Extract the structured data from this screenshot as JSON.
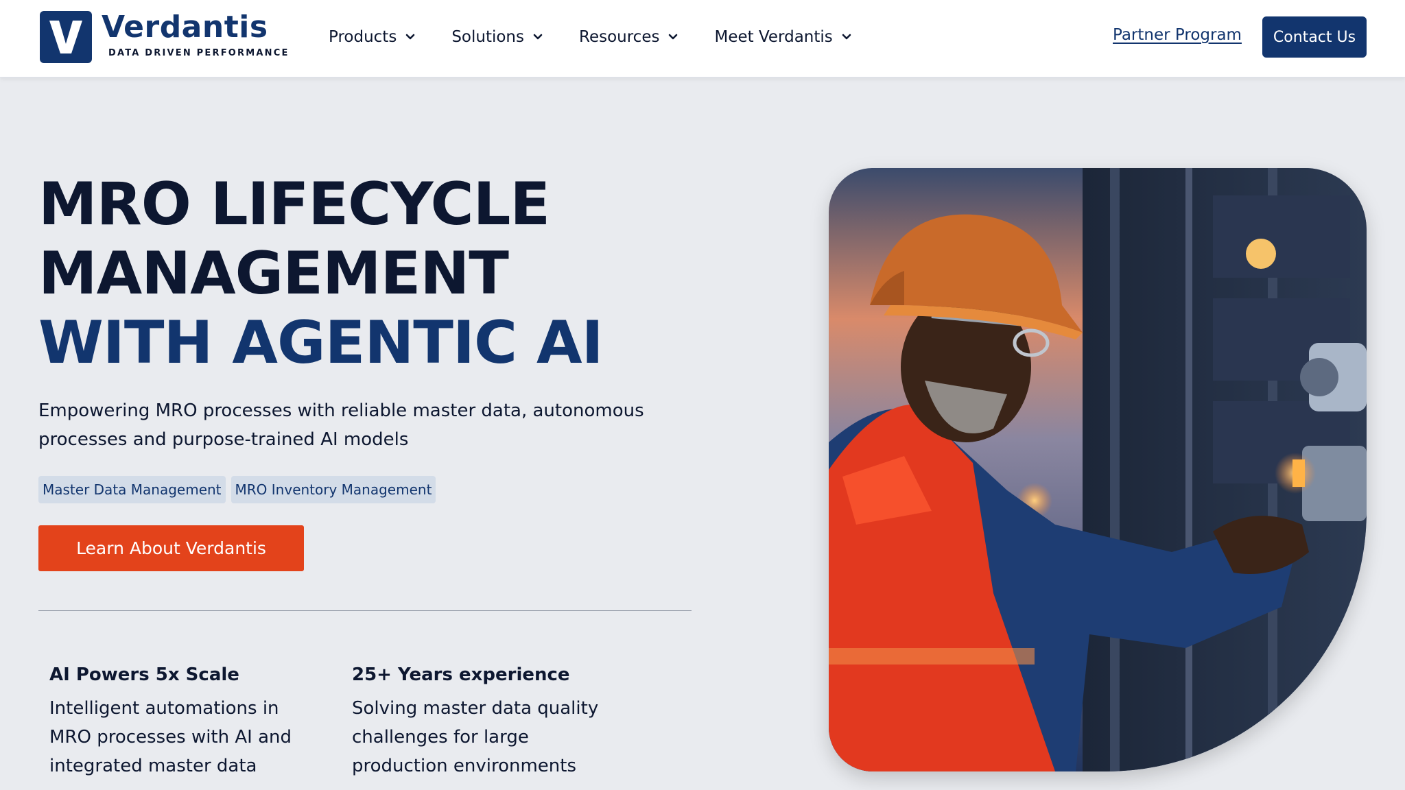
{
  "brand": {
    "name": "Verdantis",
    "tagline": "DATA DRIVEN PERFORMANCE",
    "color": "#12356e"
  },
  "nav": {
    "items": [
      {
        "label": "Products"
      },
      {
        "label": "Solutions"
      },
      {
        "label": "Resources"
      },
      {
        "label": "Meet Verdantis"
      }
    ],
    "partner_label": "Partner Program",
    "contact_label": "Contact Us"
  },
  "hero": {
    "title_line1": "MRO LIFECYCLE",
    "title_line2": "MANAGEMENT",
    "title_line3": "WITH AGENTIC AI",
    "subtitle": "Empowering MRO processes with reliable master data, autonomous processes and purpose-trained AI models",
    "tags": [
      "Master Data Management",
      "MRO Inventory Management"
    ],
    "cta_label": "Learn About Verdantis",
    "cta_color": "#e3431b"
  },
  "stats": [
    {
      "title": "AI Powers 5x Scale",
      "text": "Intelligent automations in MRO processes with AI and integrated master data"
    },
    {
      "title": "25+ Years experience",
      "text": "Solving master data quality challenges for large production environments"
    }
  ],
  "icons": {
    "logo": "v-logo-icon",
    "chevron": "chevron-down-icon"
  }
}
